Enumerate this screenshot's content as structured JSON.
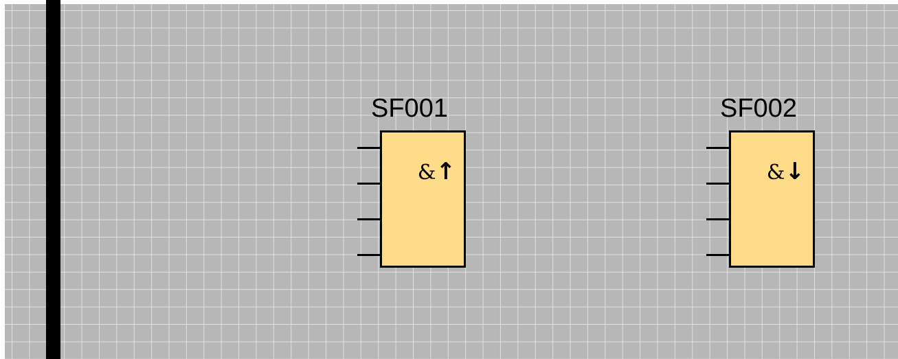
{
  "colors": {
    "canvas_background": "#b7b7b7",
    "grid_line": "#e8e8e8",
    "power_rail": "#000000",
    "block_fill": "#ffdc8a",
    "block_border": "#000000"
  },
  "blocks": [
    {
      "label": "SF001",
      "symbol_amp": "&",
      "symbol_arrow": "↑",
      "edge": "rising",
      "input_count": 4
    },
    {
      "label": "SF002",
      "symbol_amp": "&",
      "symbol_arrow": "↓",
      "edge": "falling",
      "input_count": 4
    }
  ]
}
